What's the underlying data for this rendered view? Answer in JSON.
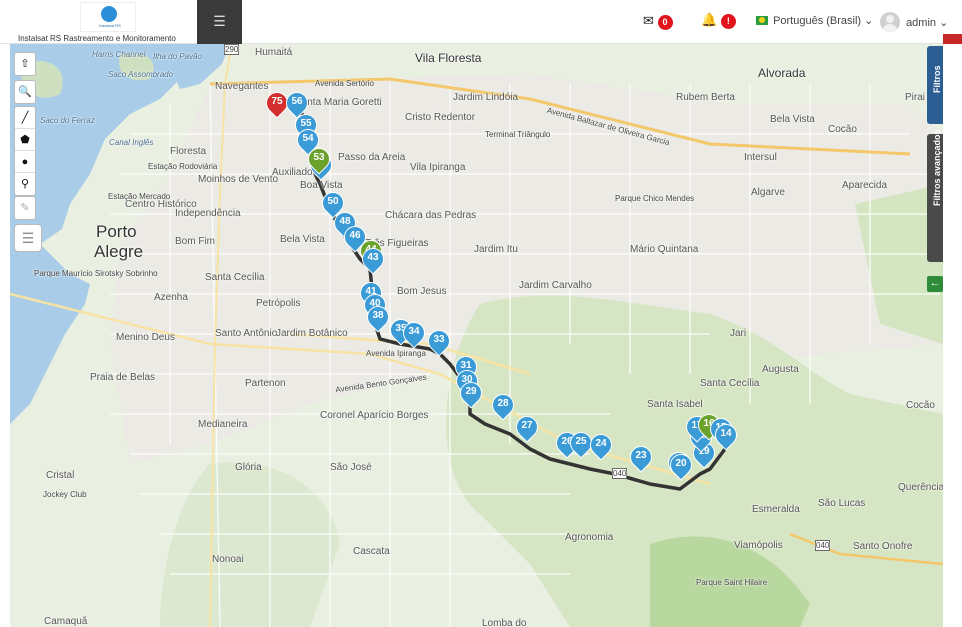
{
  "header": {
    "logo_small_text": "Instalsat RS",
    "logo_text": "Instalsat RS Rastreamento e Monitoramento",
    "menu_icon": "hamburger-icon",
    "messages_count": "0",
    "alerts_count": "!",
    "language": "Português (Brasil)",
    "user": "admin"
  },
  "map": {
    "labels": {
      "porto": "Porto",
      "alegre": "Alegre",
      "alvorada": "Alvorada",
      "vila_floresta": "Vila Floresta",
      "humaita": "Humaitá",
      "navegantes": "Navegantes",
      "santa_maria_goretti": "Santa Maria Goretti",
      "cristo_redentor": "Cristo Redentor",
      "jardim_lindoia": "Jardim Lindóia",
      "rubem_berta": "Rubem Berta",
      "bela_vista_nord": "Bela Vista",
      "cocao1": "Cocão",
      "floresta": "Floresta",
      "passo_da_areia": "Passo da Areia",
      "vila_ipiranga": "Vila Ipiranga",
      "intersul": "Intersul",
      "aparecida": "Aparecida",
      "algarve": "Algarve",
      "moinhos_de_vento": "Moinhos de Vento",
      "auxiliadora": "Auxiliadora",
      "boa_vista": "Boa Vista",
      "centro_historico": "Centro Histórico",
      "independencia": "Independência",
      "chacara_das_pedras": "Chácara das Pedras",
      "parque_chico_mendes": "Parque Chico Mendes",
      "bom_fim": "Bom Fim",
      "bela_vista": "Bela Vista",
      "tres_figueiras": "Três Figueiras",
      "jardim_itu": "Jardim Itu",
      "mario_quintana": "Mário Quintana",
      "parque_mauricio": "Parque Maurício Sirotsky Sobrinho",
      "santa_cecilia": "Santa Cecília",
      "azenha": "Azenha",
      "bom_jesus": "Bom Jesus",
      "jardim_carvalho": "Jardim Carvalho",
      "petropolis": "Petrópolis",
      "jari": "Jari",
      "menino_deus": "Menino Deus",
      "santo_antonio": "Santo Antônio",
      "jardim_botanico": "Jardim Botânico",
      "augusta": "Augusta",
      "praia_de_belas": "Praia de Belas",
      "partenon": "Partenon",
      "santa_cecilia2": "Santa Cecília",
      "santa_isabel": "Santa Isabel",
      "cocao2": "Cocão",
      "medianeira": "Medianeira",
      "coronel_aparicio_borges": "Coronel Aparício Borges",
      "gloria": "Glória",
      "sao_jose": "São José",
      "cristal": "Cristal",
      "jockey_club": "Jockey Club",
      "esmeralda": "Esmeralda",
      "sao_lucas": "São Lucas",
      "querencia": "Querência",
      "agronomia": "Agronomia",
      "viamopolis": "Viamópolis",
      "nonoai": "Nonoai",
      "cascata": "Cascata",
      "santo_onofre": "Santo Onofre",
      "parque_saint_hilaire": "Parque Saint Hilaire",
      "camagua": "Camaquã",
      "lomba_do": "Lomba do",
      "ilha_do_pavao": "Ilha do Pavão",
      "saco_assombrado": "Saco Assombrado",
      "saco_do_ferraz": "Saco do Ferraz",
      "canal_ingles": "Canal Inglês",
      "estacao_rodoviaria": "Estação Rodoviária",
      "estacao_mercado": "Estação Mercado",
      "av_sertorio": "Avenida Sertório",
      "av_baltazar": "Avenida Baltazar de Oliveira Garcia",
      "av_ipiranga": "Avenida Ipiranga",
      "av_bento": "Avenida Bento Gonçalves",
      "terminal_triangulo": "Terminal Triângulo",
      "pirai": "Pirai",
      "harris_channel": "Harris Channel",
      "br290": "290",
      "rs040": "040",
      "rs040b": "040"
    },
    "controls": [
      "upload-icon",
      "search-icon",
      "line-icon",
      "polygon-icon",
      "circle-icon",
      "marker-icon",
      "edit-icon",
      "layers-icon"
    ],
    "route_markers": [
      {
        "num": "75",
        "kind": "red"
      },
      {
        "num": "56",
        "kind": "blue"
      },
      {
        "num": "55",
        "kind": "blue"
      },
      {
        "num": "54",
        "kind": "blue"
      },
      {
        "num": "52",
        "kind": "blue"
      },
      {
        "num": "53",
        "kind": "green"
      },
      {
        "num": "50",
        "kind": "blue"
      },
      {
        "num": "48",
        "kind": "blue"
      },
      {
        "num": "46",
        "kind": "blue"
      },
      {
        "num": "44",
        "kind": "green"
      },
      {
        "num": "43",
        "kind": "blue"
      },
      {
        "num": "41",
        "kind": "blue"
      },
      {
        "num": "40",
        "kind": "blue"
      },
      {
        "num": "38",
        "kind": "blue"
      },
      {
        "num": "35",
        "kind": "blue"
      },
      {
        "num": "34",
        "kind": "blue"
      },
      {
        "num": "33",
        "kind": "blue"
      },
      {
        "num": "31",
        "kind": "blue"
      },
      {
        "num": "30",
        "kind": "blue"
      },
      {
        "num": "29",
        "kind": "blue"
      },
      {
        "num": "28",
        "kind": "blue"
      },
      {
        "num": "27",
        "kind": "blue"
      },
      {
        "num": "26",
        "kind": "blue"
      },
      {
        "num": "25",
        "kind": "blue"
      },
      {
        "num": "24",
        "kind": "blue"
      },
      {
        "num": "23",
        "kind": "blue"
      },
      {
        "num": "21",
        "kind": "blue"
      },
      {
        "num": "20",
        "kind": "blue"
      },
      {
        "num": "19",
        "kind": "blue"
      },
      {
        "num": "18",
        "kind": "blue"
      },
      {
        "num": "17",
        "kind": "blue"
      },
      {
        "num": "16",
        "kind": "green"
      },
      {
        "num": "15",
        "kind": "blue"
      },
      {
        "num": "14",
        "kind": "blue"
      }
    ]
  },
  "side_tabs": {
    "filtros": "Filtros",
    "filtros_avancados": "Filtros avançados"
  },
  "colors": {
    "route": "#333333",
    "marker_blue": "#3a9bd6",
    "marker_red": "#d32f2f",
    "marker_green": "#6aa22c",
    "water": "#a9cde8",
    "tab_blue": "#2c5e93"
  }
}
